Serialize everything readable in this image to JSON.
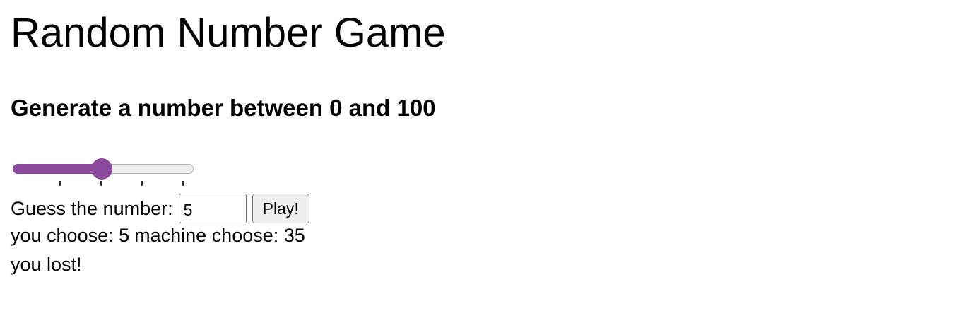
{
  "page": {
    "title": "Random Number Game",
    "subtitle": "Generate a number between 0 and 100"
  },
  "slider": {
    "value_fraction": 0.5,
    "tick_count": 4,
    "accent_color": "#8b4a9c"
  },
  "guess": {
    "label": "Guess the number:",
    "input_value": "5",
    "play_label": "Play!"
  },
  "result": {
    "you_label": "you choose: 5",
    "machine_label": "machine choose: 35",
    "outcome": "you lost!"
  }
}
